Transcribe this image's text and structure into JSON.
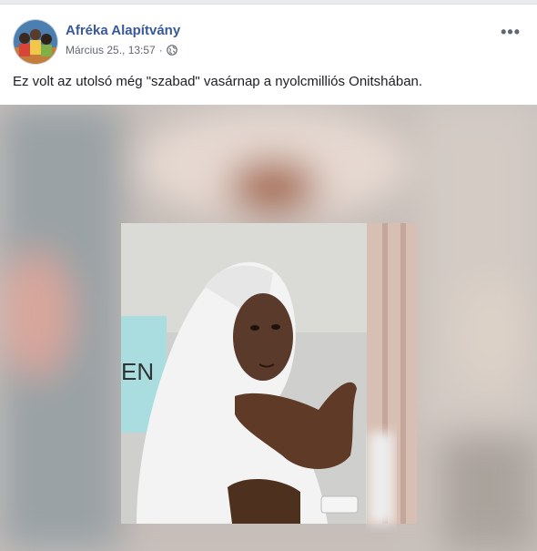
{
  "post": {
    "author": "Afréka Alapítvány",
    "timestamp": "Március 25., 13:57",
    "privacy_icon": "globe-icon",
    "more_icon": "more-options-icon",
    "more_label": "•••",
    "text": "Ez volt az utolsó még \"szabad\" vasárnap a nyolcmilliós Onitshában.",
    "media": {
      "sign_text": "EN"
    }
  },
  "colors": {
    "author": "#385898",
    "meta": "#616770",
    "text": "#1c1e21"
  }
}
